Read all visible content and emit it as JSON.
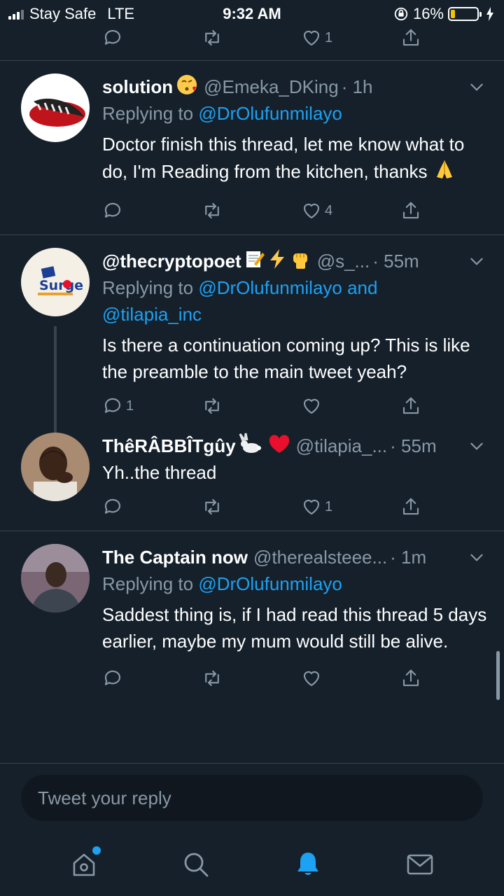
{
  "status": {
    "carrier": "Stay Safe",
    "network": "LTE",
    "time": "9:32 AM",
    "battery_pct": "16%",
    "battery_level": 0.16,
    "battery_color": "#f5c400"
  },
  "top_actions": {
    "like_count": "1"
  },
  "tweets": [
    {
      "name": "solution",
      "handle": "@Emeka_DKing",
      "time": "· 1h",
      "replying_prefix": "Replying to ",
      "replying_to": "@DrOlufunmilayo",
      "text": "Doctor finish this thread, let me know what to do, I'm Reading from the kitchen, thanks",
      "reply_count": "",
      "like_count": "4"
    },
    {
      "name": "@thecryptopoet",
      "handle": "@s_...",
      "time": "· 55m",
      "replying_prefix": "Replying to ",
      "replying_to": "@DrOlufunmilayo and",
      "replying_to_2": "@tilapia_inc",
      "text": "Is there a continuation coming up? This is like the preamble to the main tweet yeah?",
      "reply_count": "1",
      "like_count": ""
    },
    {
      "name": "ThêRÂBBÎTgûy",
      "handle": "@tilapia_...",
      "time": "· 55m",
      "text": "Yh..the thread",
      "reply_count": "",
      "like_count": "1"
    },
    {
      "name": "The Captain now",
      "handle": "@therealsteee...",
      "time": "· 1m",
      "replying_prefix": "Replying to ",
      "replying_to": "@DrOlufunmilayo",
      "text": "Saddest thing is, if I had read this thread 5 days earlier, maybe my mum would still be alive."
    }
  ],
  "composer": {
    "placeholder": "Tweet your reply"
  },
  "tabs": [
    "home-icon",
    "search-icon",
    "notifications-icon",
    "messages-icon"
  ],
  "colors": {
    "background": "#15202b",
    "accent": "#1da1f2",
    "muted": "#8899a6",
    "divider": "#38444d"
  }
}
